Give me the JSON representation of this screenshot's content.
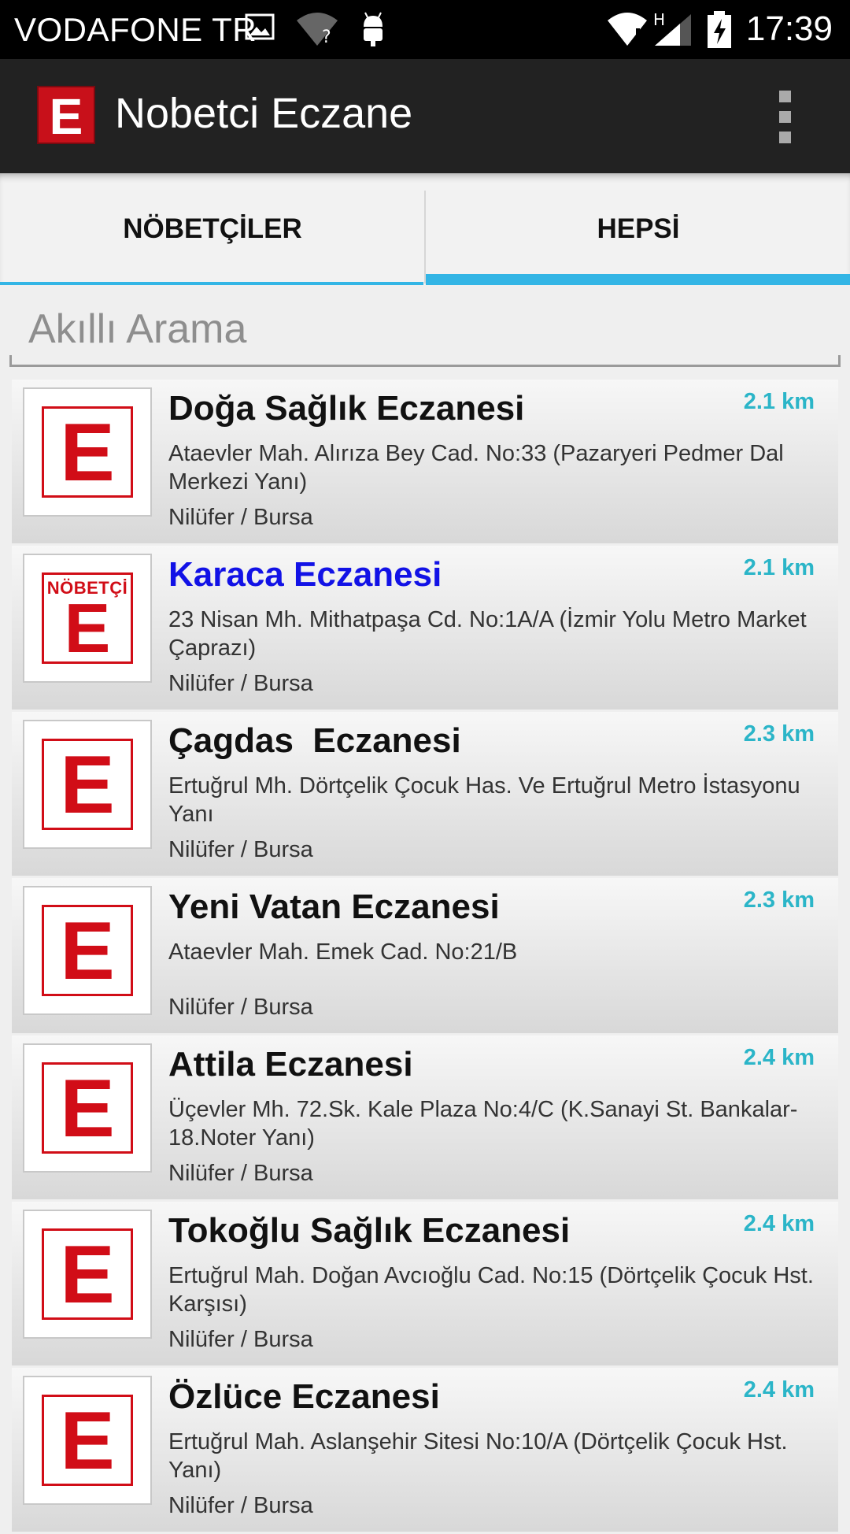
{
  "status_bar": {
    "carrier": "VODAFONE TR",
    "time": "17:39",
    "network_label": "H",
    "icons": [
      "image-icon",
      "wifi-unknown-icon",
      "android-icon",
      "signal-icon",
      "battery-charging-icon"
    ]
  },
  "action_bar": {
    "logo_letter": "E",
    "title": "Nobetci Eczane",
    "menu_icon": "overflow-menu-icon"
  },
  "tabs": [
    {
      "label": "NÖBETÇİLER",
      "selected": false
    },
    {
      "label": "HEPSİ",
      "selected": true
    }
  ],
  "search": {
    "placeholder": "Akıllı Arama",
    "value": ""
  },
  "colors": {
    "accent": "#33b5e5",
    "distance": "#2bb5c8",
    "highlight_name": "#1212e6",
    "logo_red": "#d10d17"
  },
  "pharmacies": [
    {
      "name": "Doğa Sağlık Eczanesi",
      "distance": "2.1 km",
      "address": "Ataevler Mah. Alırıza Bey Cad. No:33 (Pazaryeri Pedmer Dal Merkezi Yanı)",
      "city": "Nilüfer / Bursa",
      "logo": "E",
      "on_duty": false
    },
    {
      "name": "Karaca Eczanesi",
      "distance": "2.1 km",
      "address": "23 Nisan Mh. Mithatpaşa Cd. No:1A/A (İzmir Yolu Metro Market Çaprazı)",
      "city": "Nilüfer / Bursa",
      "logo": "E",
      "on_duty": true,
      "on_duty_label": "NÖBETÇİ"
    },
    {
      "name": "Çagdas  Eczanesi",
      "distance": "2.3 km",
      "address": "Ertuğrul Mh. Dörtçelik Çocuk Has. Ve Ertuğrul Metro İstasyonu Yanı",
      "city": "Nilüfer / Bursa",
      "logo": "E",
      "on_duty": false
    },
    {
      "name": "Yeni Vatan Eczanesi",
      "distance": "2.3 km",
      "address": "Ataevler Mah. Emek Cad. No:21/B",
      "city": "Nilüfer / Bursa",
      "logo": "E",
      "on_duty": false
    },
    {
      "name": "Attila Eczanesi",
      "distance": "2.4 km",
      "address": "Üçevler Mh. 72.Sk. Kale Plaza No:4/C (K.Sanayi St. Bankalar-18.Noter Yanı)",
      "city": "Nilüfer / Bursa",
      "logo": "E",
      "on_duty": false
    },
    {
      "name": "Tokoğlu Sağlık Eczanesi",
      "distance": "2.4 km",
      "address": "Ertuğrul Mah. Doğan Avcıoğlu Cad. No:15 (Dörtçelik Çocuk Hst. Karşısı)",
      "city": "Nilüfer / Bursa",
      "logo": "E",
      "on_duty": false
    },
    {
      "name": "Özlüce Eczanesi",
      "distance": "2.4 km",
      "address": "Ertuğrul Mah. Aslanşehir Sitesi No:10/A (Dörtçelik Çocuk Hst. Yanı)",
      "city": "Nilüfer / Bursa",
      "logo": "E",
      "on_duty": false
    }
  ]
}
